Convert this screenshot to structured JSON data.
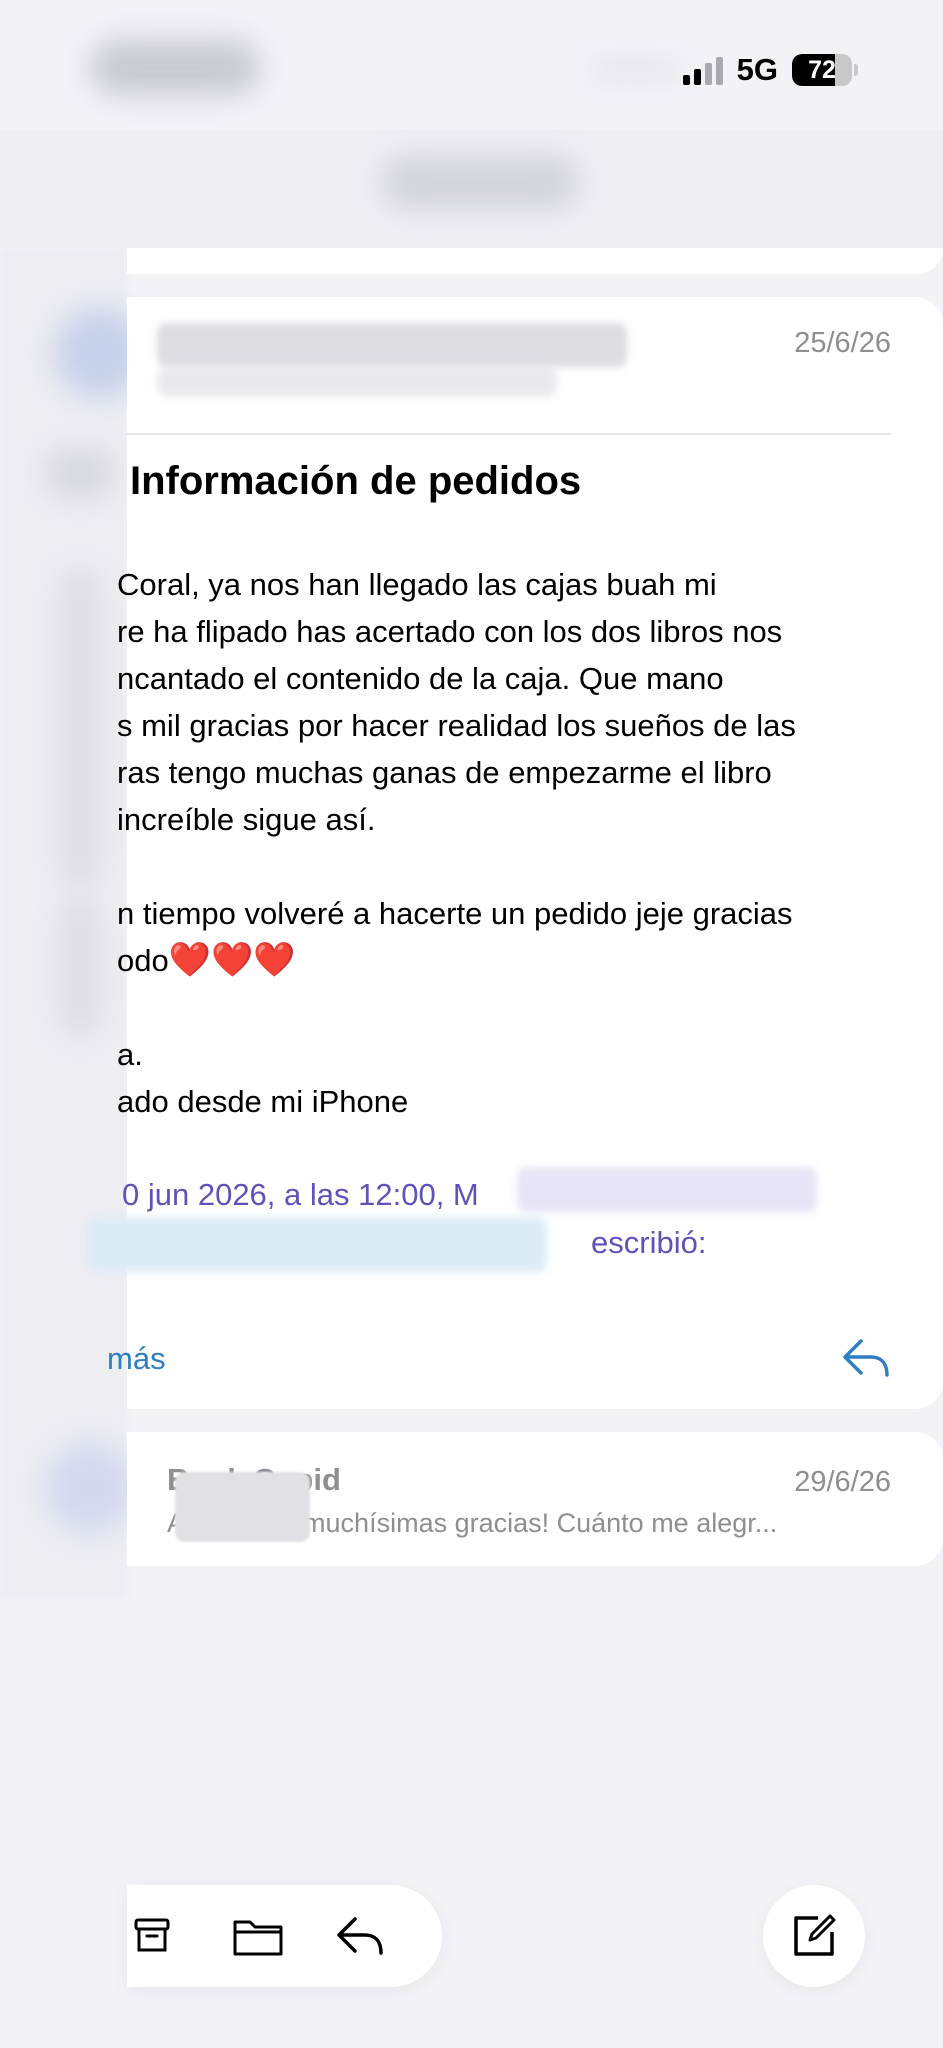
{
  "status_bar": {
    "network": "5G",
    "battery": "72",
    "battery_level": 0.72
  },
  "thread": {
    "message": {
      "date": "25/6/26",
      "subject": "Información de pedidos",
      "body_lines": [
        "Coral, ya nos han llegado las cajas buah mi",
        "re ha flipado has acertado con los dos libros nos",
        "ncantado el contenido de la caja. Que mano",
        "s mil gracias por hacer realidad los sueños de las",
        "ras tengo muchas ganas de empezarme el libro",
        "increíble sigue así.",
        "n tiempo volveré a hacerte un pedido jeje gracias",
        "odo",
        "a.",
        "ado desde mi iPhone"
      ],
      "hearts": "❤️❤️❤️",
      "quote_header": "0 jun 2026, a las 12:00, M",
      "quote_wrote": "escribió:",
      "more_label": "más"
    },
    "reply": {
      "sender": "Book Cupid",
      "date": "29/6/26",
      "preview": "Ayy mana ¡muchísimas gracias! Cuánto me alegr..."
    }
  },
  "colors": {
    "accent": "#2f7dc3",
    "quote": "#5d53b8",
    "secondary_text": "#8e8e93"
  },
  "icons": {
    "toolbar": [
      "archive-icon",
      "folder-icon",
      "reply-icon"
    ],
    "compose": "compose-icon",
    "card_reply": "reply-icon"
  }
}
